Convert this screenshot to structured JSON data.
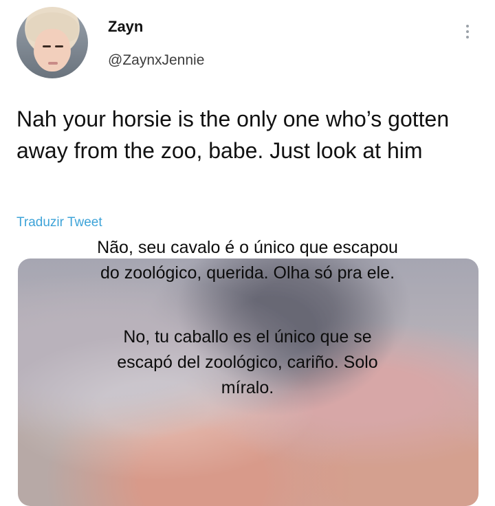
{
  "tweet": {
    "author_name": "Zayn",
    "author_handle": "@ZaynxJennie",
    "text": "Nah your horsie is the only one who’s gotten away from the zoo, babe. Just look at him",
    "translate_label": "Traduzir Tweet",
    "more_icon": "more-vertical-icon",
    "link_color": "#3da3d8"
  },
  "overlay": {
    "portuguese_line1": "Não, seu cavalo é o único que escapou",
    "portuguese_line2": "do zoológico, querida. Olha só pra ele.",
    "spanish_line1": "No, tu caballo es el único que se",
    "spanish_line2": "escapó del zoológico, cariño. Solo",
    "spanish_line3": "míralo."
  }
}
